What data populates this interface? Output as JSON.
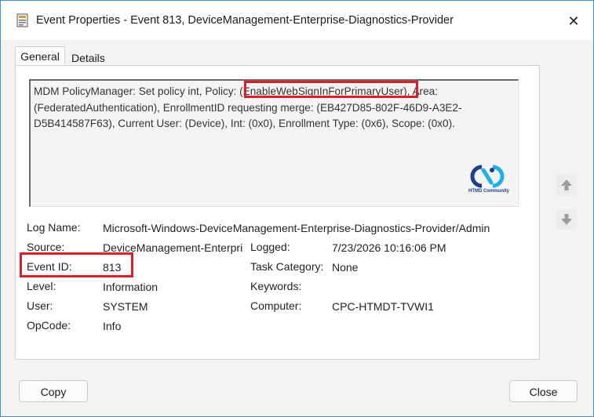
{
  "window": {
    "title": "Event Properties - Event 813, DeviceManagement-Enterprise-Diagnostics-Provider",
    "close_glyph": "✕"
  },
  "tabs": [
    {
      "label": "General",
      "selected": true
    },
    {
      "label": "Details",
      "selected": false
    }
  ],
  "event": {
    "message": "MDM PolicyManager: Set policy int, Policy: (EnableWebSignInForPrimaryUser), Area: (FederatedAuthentication), EnrollmentID requesting merge: (EB427D85-802F-46D9-A3E2-D5B414587F63), Current User: (Device), Int: (0x0), Enrollment Type: (0x6), Scope: (0x0).",
    "logo_text": "HTMD Community",
    "fields": {
      "log_name": {
        "label": "Log Name:",
        "value": "Microsoft-Windows-DeviceManagement-Enterprise-Diagnostics-Provider/Admin"
      },
      "source": {
        "label": "Source:",
        "value": "DeviceManagement-Enterpri"
      },
      "logged": {
        "label": "Logged:",
        "value": "7/23/2026 10:16:06 PM"
      },
      "event_id": {
        "label": "Event ID:",
        "value": "813"
      },
      "task_category": {
        "label": "Task Category:",
        "value": "None"
      },
      "level": {
        "label": "Level:",
        "value": "Information"
      },
      "keywords": {
        "label": "Keywords:",
        "value": ""
      },
      "user": {
        "label": "User:",
        "value": "SYSTEM"
      },
      "computer": {
        "label": "Computer:",
        "value": "CPC-HTMDT-TVWI1"
      },
      "opcode": {
        "label": "OpCode:",
        "value": "Info"
      }
    }
  },
  "buttons": {
    "copy": "Copy",
    "close": "Close"
  },
  "colors": {
    "highlight": "#d8202a",
    "window_border": "#3c8fd4",
    "logo_blue": "#1f3e8c",
    "logo_cyan": "#1fb1e6"
  },
  "icons": {
    "scroll_up": "arrow-up-icon",
    "scroll_down": "arrow-down-icon",
    "app": "event-viewer-icon"
  }
}
